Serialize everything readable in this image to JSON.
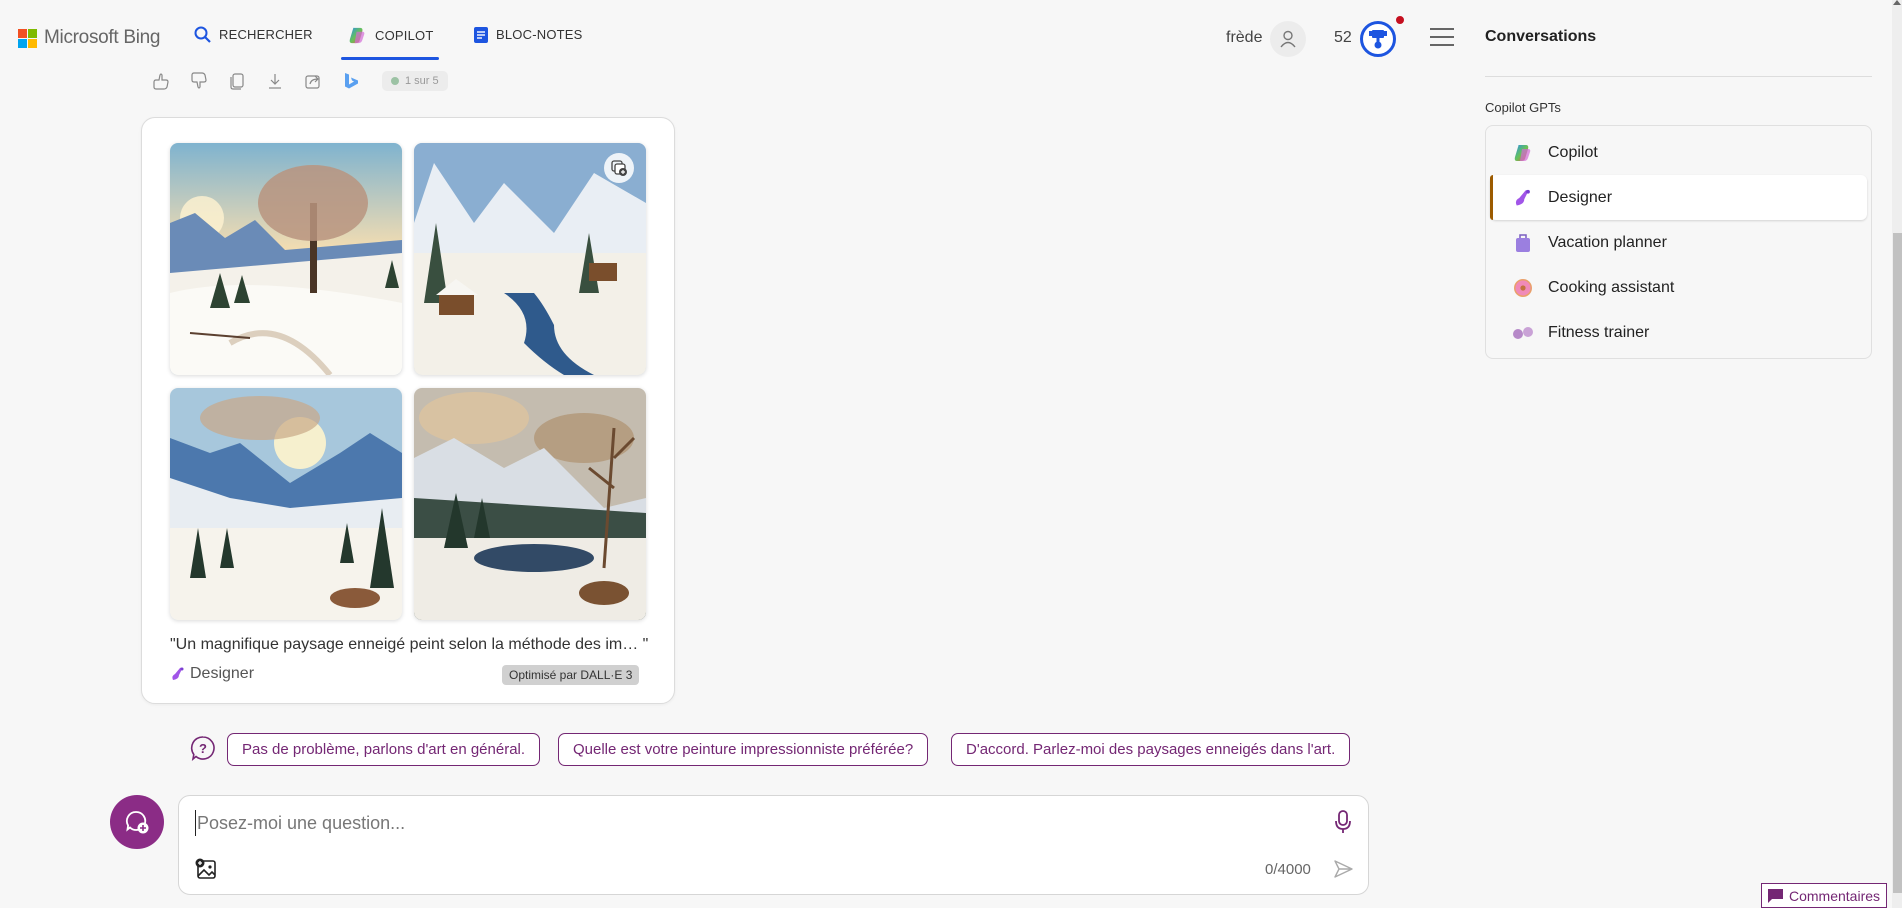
{
  "header": {
    "brand": "Microsoft Bing",
    "brand_colors": [
      "#f25022",
      "#7fba00",
      "#00a4ef",
      "#ffb900"
    ],
    "nav": [
      {
        "label": "RECHERCHER",
        "icon": "search-icon"
      },
      {
        "label": "COPILOT",
        "icon": "copilot-icon",
        "active": true
      },
      {
        "label": "BLOC-NOTES",
        "icon": "notebook-icon"
      }
    ],
    "user_name": "frède",
    "points": "52",
    "accent": "#1d55e0"
  },
  "actions": {
    "icons": [
      "thumbs-up-icon",
      "thumbs-down-icon",
      "copy-icon",
      "download-icon",
      "share-icon",
      "bing-icon"
    ],
    "page_indicator": "1 sur 5"
  },
  "image_card": {
    "images": [
      {
        "alt": "Paysage enneigé avec grand arbre et soleil"
      },
      {
        "alt": "Vallée enneigée avec rivière et chalets"
      },
      {
        "alt": "Vallée de montagne enneigée au soleil"
      },
      {
        "alt": "Lac de montagne enneigé avec arbres"
      }
    ],
    "caption": "\"Un magnifique paysage enneigé peint selon la méthode des im…  \"",
    "source": "Designer",
    "badge": "Optimisé par DALL·E 3"
  },
  "suggestions": [
    "Pas de problème, parlons d'art en général.",
    "Quelle est votre peinture impressionniste préférée?",
    "D'accord. Parlez-moi des paysages enneigés dans l'art."
  ],
  "input": {
    "value": "",
    "placeholder": "Posez-moi une question...",
    "char_count": "0/4000"
  },
  "sidebar": {
    "title": "Conversations",
    "section_label": "Copilot GPTs",
    "items": [
      {
        "label": "Copilot",
        "icon": "copilot-icon",
        "active": false
      },
      {
        "label": "Designer",
        "icon": "designer-icon",
        "active": true
      },
      {
        "label": "Vacation planner",
        "icon": "suitcase-icon",
        "active": false
      },
      {
        "label": "Cooking assistant",
        "icon": "donut-icon",
        "active": false
      },
      {
        "label": "Fitness trainer",
        "icon": "dumbbell-icon",
        "active": false
      }
    ]
  },
  "feedback": {
    "label": "Commentaires"
  },
  "theme": {
    "purple": "#742774",
    "avatar_bg": "#8b2c86"
  }
}
